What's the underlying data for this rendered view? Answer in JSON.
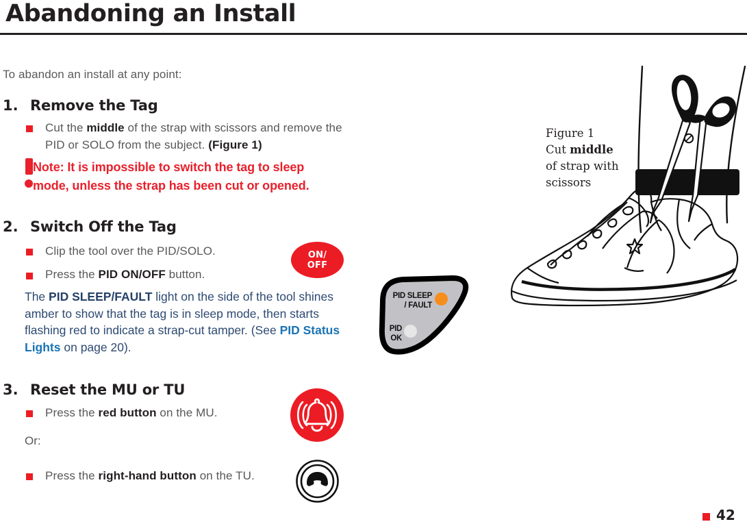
{
  "document": {
    "title": "Abandoning an Install",
    "intro": "To abandon an install at any point:",
    "page_number": "42"
  },
  "steps": [
    {
      "number": "1.",
      "heading": "Remove the Tag",
      "bullets": [
        {
          "pre": "Cut the ",
          "bold": "middle",
          "post": " of the strap with scissors and remove the PID or SOLO from the subject. ",
          "bold2": "(Figure 1)"
        }
      ]
    },
    {
      "number": "2.",
      "heading": "Switch Off the Tag",
      "bullets": [
        {
          "pre": "Clip the tool over the PID/SOLO.",
          "bold": "",
          "post": ""
        },
        {
          "pre": "Press the ",
          "bold": "PID ON/OFF",
          "post": " button."
        }
      ]
    },
    {
      "number": "3.",
      "heading": "Reset the MU or TU",
      "bullets": [
        {
          "pre": "Press the ",
          "bold": "red button",
          "post": " on the MU."
        },
        {
          "pre": "Press the ",
          "bold": "right-hand button",
          "post": " on the TU."
        }
      ]
    }
  ],
  "note": {
    "line1": "Note: It is impossible to switch the tag to sleep",
    "line2": "mode, unless the strap has been cut or opened."
  },
  "status_paragraph": {
    "seg1": "The ",
    "bold1": "PID SLEEP/FAULT",
    "seg2": " light on the side of the tool shines amber to show that the tag is in sleep mode, then starts flashing red to indicate a strap-cut tamper. (See ",
    "link": "PID Status Lights",
    "seg3": " on page 20)."
  },
  "or_label": "Or:",
  "onoff_button": {
    "line1": "ON/",
    "line2": "OFF"
  },
  "tool_device": {
    "sleep_label_line1": "PID SLEEP",
    "sleep_label_line2": "/ FAULT",
    "ok_label_line1": "PID",
    "ok_label_line2": "OK",
    "sleep_led_color": "#f68e1e",
    "ok_led_color": "#e6e6e6",
    "body_color": "#c2c2c6"
  },
  "figure": {
    "caption_line1": "Figure 1",
    "caption_line2_pre": "Cut ",
    "caption_line2_bold": "middle",
    "caption_line3": "of strap with",
    "caption_line4": "scissors"
  },
  "colors": {
    "accent_red": "#ec1c24",
    "navy": "#2d4a72",
    "link_blue": "#1a74b4",
    "body_gray": "#58585a",
    "ink": "#231f20"
  }
}
